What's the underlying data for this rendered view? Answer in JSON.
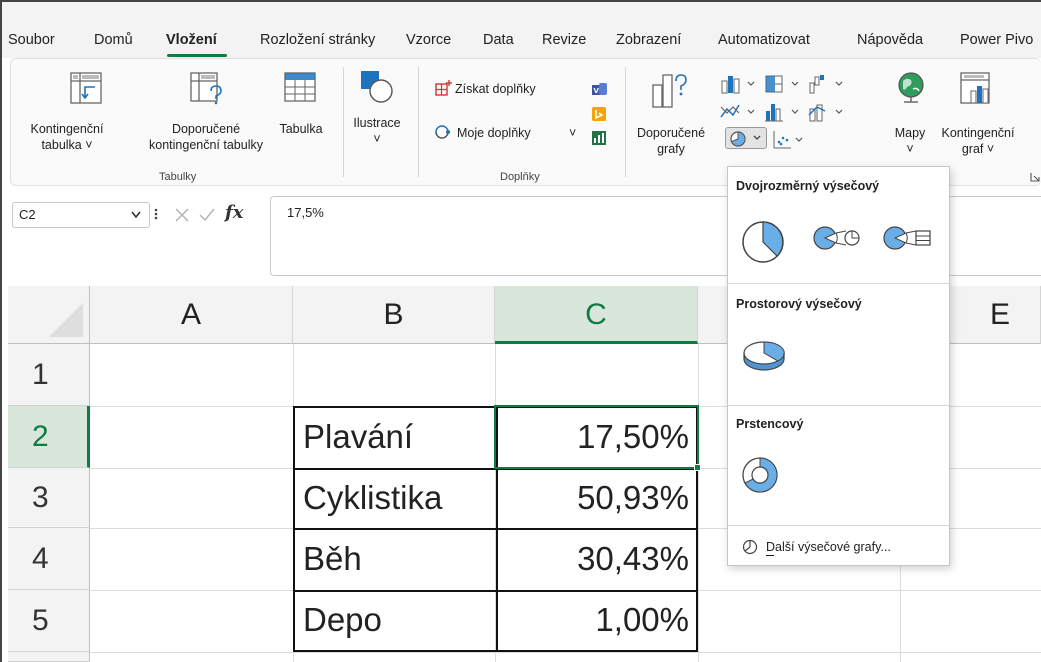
{
  "tabs": [
    "Soubor",
    "Domů",
    "Vložení",
    "Rozložení stránky",
    "Vzorce",
    "Data",
    "Revize",
    "Zobrazení",
    "Automatizovat",
    "Nápověda",
    "Power Pivo"
  ],
  "ribbon": {
    "pivot_table": {
      "line1": "Kontingenční",
      "line2": "tabulka ˅"
    },
    "recommended_pivot": {
      "line1": "Doporučené",
      "line2": "kontingenční tabulky"
    },
    "table": "Tabulka",
    "illustrations": {
      "line1": "Ilustrace",
      "line2": "˅"
    },
    "group_tables": "Tabulky",
    "get_addins": "Získat doplňky",
    "my_addins": "Moje doplňky",
    "my_addins_arrow": "˅",
    "group_addins": "Doplňky",
    "recommended_charts": {
      "line1": "Doporučené",
      "line2": "grafy"
    },
    "maps": {
      "line1": "Mapy",
      "line2": "˅"
    },
    "pivot_chart": {
      "line1": "Kontingenční",
      "line2": "graf ˅"
    }
  },
  "formula_bar": {
    "cell_ref": "C2",
    "fx": "fx",
    "value": "17,5%"
  },
  "columns": [
    "A",
    "B",
    "C",
    "E"
  ],
  "rows": [
    "1",
    "2",
    "3",
    "4",
    "5"
  ],
  "table": [
    {
      "label": "Plavání",
      "value": "17,50%"
    },
    {
      "label": "Cyklistika",
      "value": "50,93%"
    },
    {
      "label": "Běh",
      "value": "30,43%"
    },
    {
      "label": "Depo",
      "value": "1,00%"
    }
  ],
  "pie_menu": {
    "section_2d": "Dvojrozměrný výsečový",
    "section_3d": "Prostorový výsečový",
    "section_donut": "Prstencový",
    "more": "Další výsečové grafy..."
  },
  "colors": {
    "accent": "#107c41",
    "pie_blue": "#6aaee8"
  }
}
